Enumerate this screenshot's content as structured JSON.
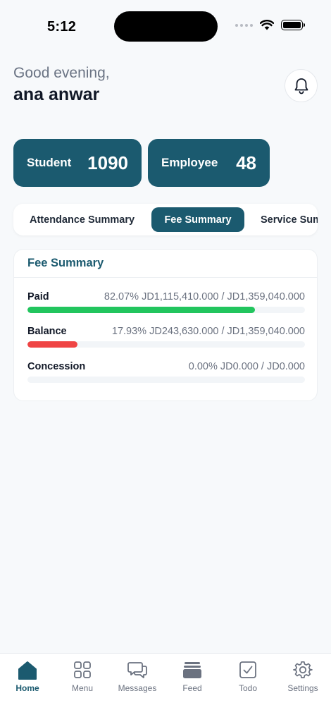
{
  "status_bar": {
    "time": "5:12"
  },
  "header": {
    "greeting": "Good evening,",
    "user_name": "ana anwar"
  },
  "stats": [
    {
      "label": "Student",
      "value": "1090"
    },
    {
      "label": "Employee",
      "value": "48"
    }
  ],
  "tabs": [
    {
      "label": "Attendance Summary",
      "active": false
    },
    {
      "label": "Fee Summary",
      "active": true
    },
    {
      "label": "Service Summary",
      "active": false
    }
  ],
  "fee_summary": {
    "title": "Fee Summary",
    "rows": [
      {
        "label": "Paid",
        "value": "82.07% JD1,115,410.000 / JD1,359,040.000",
        "percent": 82.07,
        "color": "#22c55e"
      },
      {
        "label": "Balance",
        "value": "17.93% JD243,630.000 / JD1,359,040.000",
        "percent": 17.93,
        "color": "#ef4444"
      },
      {
        "label": "Concession",
        "value": "0.00% JD0.000 / JD0.000",
        "percent": 0,
        "color": "#22c55e"
      }
    ]
  },
  "bottom_nav": [
    {
      "label": "Home",
      "icon": "home-icon",
      "active": true
    },
    {
      "label": "Menu",
      "icon": "grid-icon",
      "active": false
    },
    {
      "label": "Messages",
      "icon": "chat-icon",
      "active": false
    },
    {
      "label": "Feed",
      "icon": "feed-icon",
      "active": false
    },
    {
      "label": "Todo",
      "icon": "checkbox-icon",
      "active": false
    },
    {
      "label": "Settings",
      "icon": "gear-icon",
      "active": false
    }
  ],
  "colors": {
    "primary": "#1b5a6f",
    "paid": "#22c55e",
    "balance": "#ef4444",
    "muted": "#6b7280"
  }
}
